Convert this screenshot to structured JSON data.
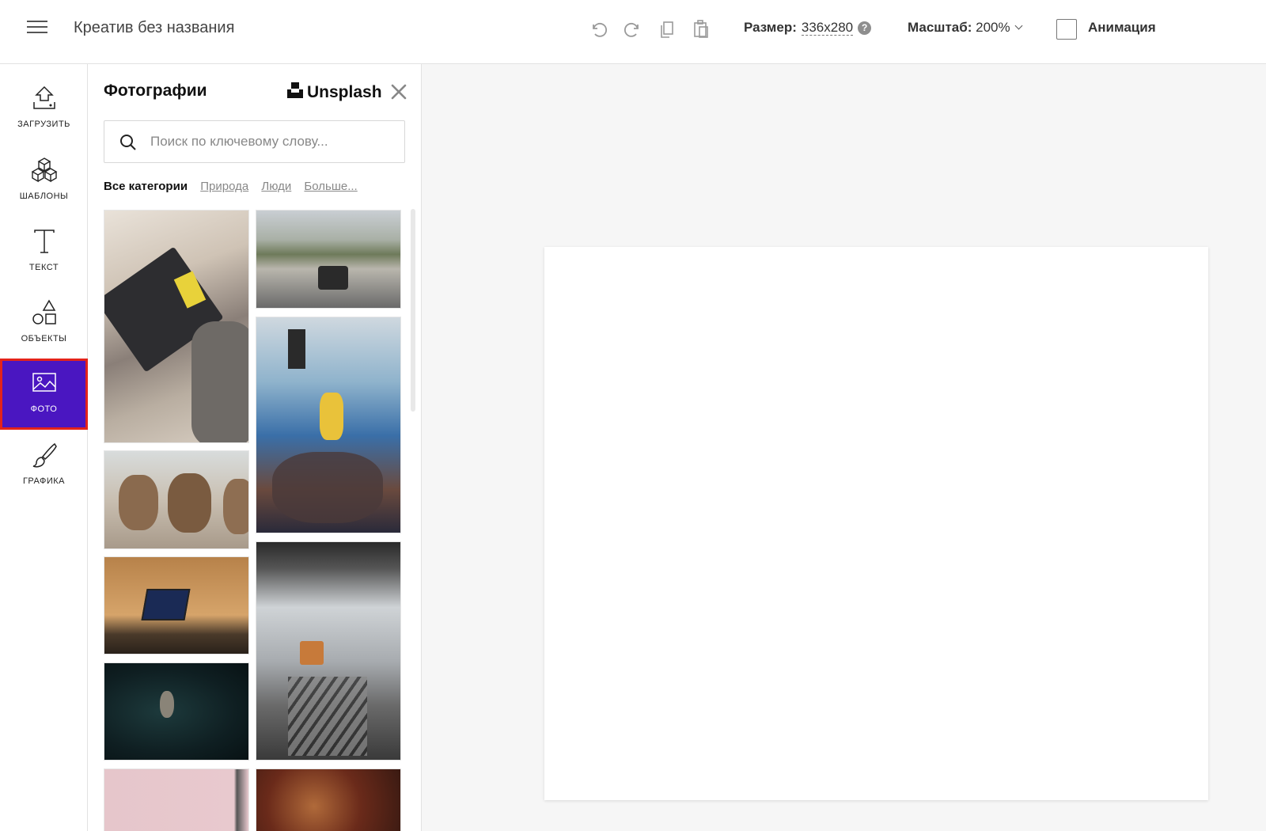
{
  "header": {
    "doc_title": "Креатив без названия",
    "size_label": "Размер:",
    "size_value": "336x280",
    "zoom_label": "Масштаб:",
    "zoom_value": "200%",
    "animation_label": "Анимация",
    "icons": [
      "menu-icon",
      "undo-icon",
      "redo-icon",
      "copy-icon",
      "paste-icon",
      "help-icon",
      "chevron-down-icon"
    ]
  },
  "rail": {
    "items": [
      {
        "label": "ЗАГРУЗИТЬ",
        "icon": "upload-icon"
      },
      {
        "label": "ШАБЛОНЫ",
        "icon": "cubes-icon"
      },
      {
        "label": "ТЕКСТ",
        "icon": "text-icon"
      },
      {
        "label": "ОБЪЕКТЫ",
        "icon": "shapes-icon"
      },
      {
        "label": "ФОТО",
        "icon": "photo-icon",
        "active": true
      },
      {
        "label": "ГРАФИКА",
        "icon": "brush-icon"
      }
    ]
  },
  "panel": {
    "title": "Фотографии",
    "provider": "Unsplash",
    "search_placeholder": "Поиск по ключевому слову...",
    "categories": [
      {
        "label": "Все категории",
        "active": true
      },
      {
        "label": "Природа",
        "active": false
      },
      {
        "label": "Люди",
        "active": false
      },
      {
        "label": "Больше...",
        "active": false
      }
    ]
  },
  "colors": {
    "accent": "#4a16c1",
    "highlight": "#e3231b"
  }
}
